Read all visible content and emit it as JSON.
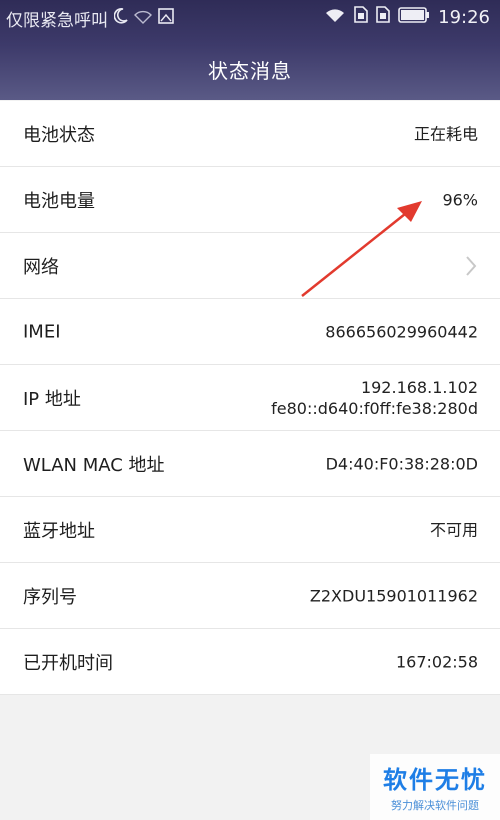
{
  "statusbar": {
    "carrier": "仅限紧急呼叫",
    "time": "19:26"
  },
  "page": {
    "title": "状态消息"
  },
  "rows": [
    {
      "label": "电池状态",
      "value": "正在耗电"
    },
    {
      "label": "电池电量",
      "value": "96%"
    },
    {
      "label": "网络",
      "value": ""
    },
    {
      "label": "IMEI",
      "value": "866656029960442"
    },
    {
      "label": "IP 地址",
      "value": "192.168.1.102",
      "value2": "fe80::d640:f0ff:fe38:280d"
    },
    {
      "label": "WLAN MAC 地址",
      "value": "D4:40:F0:38:28:0D"
    },
    {
      "label": "蓝牙地址",
      "value": "不可用"
    },
    {
      "label": "序列号",
      "value": "Z2XDU15901011962"
    },
    {
      "label": "已开机时间",
      "value": "167:02:58"
    }
  ],
  "watermark": {
    "main": "软件无忧",
    "sub": "努力解决软件问题"
  },
  "colors": {
    "header": "#3a3767",
    "arrow": "#e23a2e",
    "watermark": "#1e7ee6"
  }
}
